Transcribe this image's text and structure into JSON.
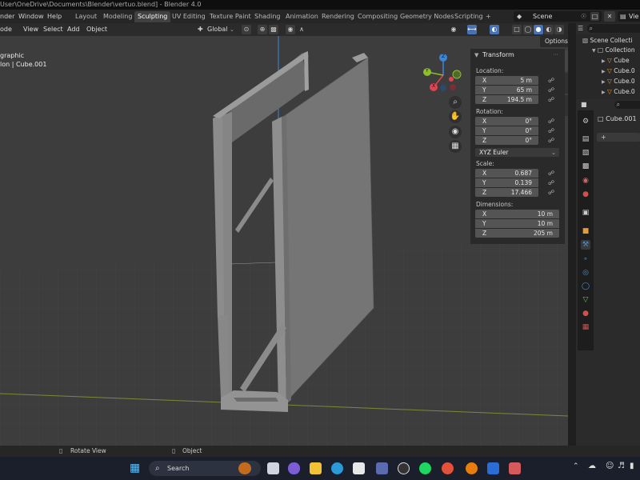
{
  "title": "User\\OneDrive\\Documents\\Blender\\vertuo.blend] - Blender 4.0",
  "menu": [
    "nder",
    "Window",
    "Help"
  ],
  "workspaces": [
    {
      "label": "Layout",
      "active": false
    },
    {
      "label": "Modeling",
      "active": false
    },
    {
      "label": "Sculpting",
      "active": true
    },
    {
      "label": "UV Editing",
      "active": false
    },
    {
      "label": "Texture Paint",
      "active": false
    },
    {
      "label": "Shading",
      "active": false
    },
    {
      "label": "Animation",
      "active": false
    },
    {
      "label": "Rendering",
      "active": false
    },
    {
      "label": "Compositing",
      "active": false
    },
    {
      "label": "Geometry Nodes",
      "active": false
    },
    {
      "label": "Scripting",
      "active": false
    }
  ],
  "add_workspace": "+",
  "scene_label": "Scene",
  "view_layer_label": "Vie",
  "header": {
    "mode": "ode",
    "view": "View",
    "select": "Select",
    "add": "Add",
    "object": "Object",
    "orientation": "Global",
    "options": "Options"
  },
  "viewport": {
    "overlay_line1": "graphic",
    "overlay_line2": "lon | Cube.001",
    "gizmo": {
      "x": "X",
      "y": "Y",
      "z": "Z"
    }
  },
  "n_tabs": [
    "Item",
    "Tool",
    "View"
  ],
  "transform": {
    "heading": "Transform",
    "location_label": "Location:",
    "location": [
      {
        "axis": "X",
        "value": "5 m"
      },
      {
        "axis": "Y",
        "value": "65 m"
      },
      {
        "axis": "Z",
        "value": "194.5 m"
      }
    ],
    "rotation_label": "Rotation:",
    "rotation": [
      {
        "axis": "X",
        "value": "0°"
      },
      {
        "axis": "Y",
        "value": "0°"
      },
      {
        "axis": "Z",
        "value": "0°"
      }
    ],
    "rotation_mode": "XYZ Euler",
    "scale_label": "Scale:",
    "scale": [
      {
        "axis": "X",
        "value": "0.687"
      },
      {
        "axis": "Y",
        "value": "0.139"
      },
      {
        "axis": "Z",
        "value": "17.466"
      }
    ],
    "dimensions_label": "Dimensions:",
    "dimensions": [
      {
        "axis": "X",
        "value": "10 m"
      },
      {
        "axis": "Y",
        "value": "10 m"
      },
      {
        "axis": "Z",
        "value": "205 m"
      }
    ]
  },
  "outliner": {
    "scene_collection": "Scene Collecti",
    "collection": "Collection",
    "items": [
      "Cube",
      "Cube.0",
      "Cube.0",
      "Cube.0"
    ]
  },
  "properties": {
    "object_name": "Cube.001",
    "add": "+"
  },
  "status": {
    "rotate": "Rotate View",
    "object": "Object"
  },
  "taskbar": {
    "search": "Search"
  },
  "colors": {
    "accent": "#4772b3",
    "viewport_bg": "#3d3d3d",
    "x_axis": "#e4424e",
    "y_axis": "#8bbf2c",
    "z_axis": "#3f85d6",
    "object_orange": "#e69a3c"
  }
}
